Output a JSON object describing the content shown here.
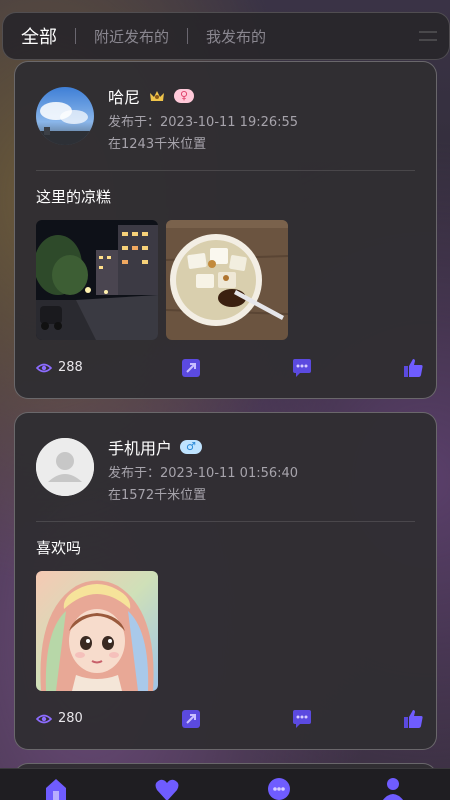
{
  "tabs": [
    {
      "label": "全部",
      "active": true
    },
    {
      "label": "附近发布的",
      "active": false
    },
    {
      "label": "我发布的",
      "active": false
    }
  ],
  "posts": [
    {
      "username": "哈尼",
      "gender": "female",
      "gender_symbol": "♀",
      "vip": true,
      "published": "发布于：2023-10-11 19:26:55",
      "distance": "在1243千米位置",
      "text": "这里的凉糕",
      "views": "288",
      "photos": [
        "street-night-photo",
        "liang-gao-dessert-photo"
      ]
    },
    {
      "username": "手机用户",
      "gender": "male",
      "gender_symbol": "♂",
      "vip": false,
      "published": "发布于：2023-10-11 01:56:40",
      "distance": "在1572千米位置",
      "text": "喜欢吗",
      "views": "280",
      "photos": [
        "doll-portrait-photo"
      ]
    }
  ],
  "actions": [
    "eye-icon",
    "share-icon",
    "comment-icon",
    "like-icon"
  ],
  "bottom_nav": [
    "home-icon",
    "heart-icon",
    "message-icon",
    "profile-icon"
  ],
  "colors": {
    "accent": "#7a5cff",
    "female_badge": "#ffc9d9",
    "male_badge": "#bfe3ff",
    "card_bg": "#302e32"
  }
}
